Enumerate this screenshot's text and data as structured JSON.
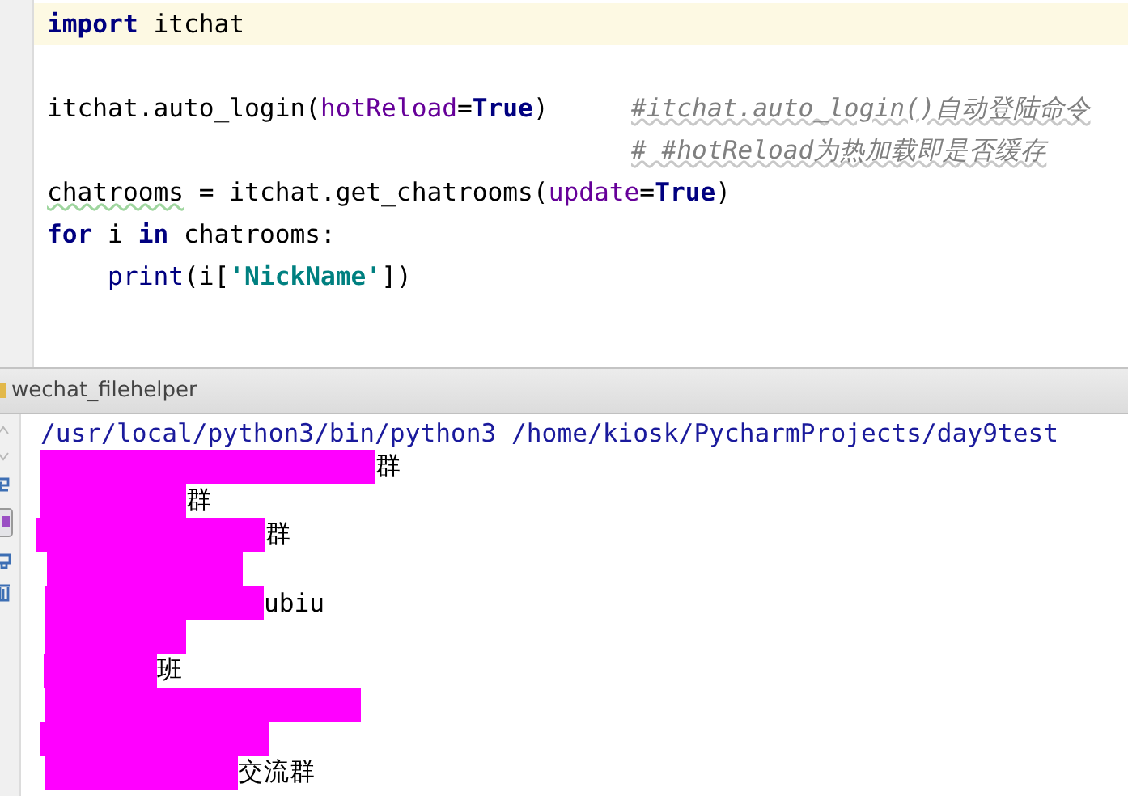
{
  "editor": {
    "lines": [
      {
        "current": true,
        "tokens": [
          {
            "kind": "keyword",
            "text": "import"
          },
          {
            "kind": "plain",
            "text": " itchat"
          }
        ]
      },
      {
        "current": false
      },
      {
        "current": false,
        "tokens": [
          {
            "kind": "plain",
            "text": "itchat.auto_login("
          },
          {
            "kind": "param",
            "text": "hotReload"
          },
          {
            "kind": "plain",
            "text": "="
          },
          {
            "kind": "keyword",
            "text": "True"
          },
          {
            "kind": "plain",
            "text": ")"
          }
        ],
        "comment": "#itchat.auto_login()自动登陆命令"
      },
      {
        "current": false,
        "comment": "# #hotReload为热加载即是否缓存"
      },
      {
        "current": false,
        "tokens": [
          {
            "kind": "warn",
            "text": "chatrooms"
          },
          {
            "kind": "plain",
            "text": " = itchat.get_chatrooms("
          },
          {
            "kind": "param",
            "text": "update"
          },
          {
            "kind": "plain",
            "text": "="
          },
          {
            "kind": "keyword",
            "text": "True"
          },
          {
            "kind": "plain",
            "text": ")"
          }
        ]
      },
      {
        "current": false,
        "tokens": [
          {
            "kind": "keyword",
            "text": "for"
          },
          {
            "kind": "plain",
            "text": " i "
          },
          {
            "kind": "keyword",
            "text": "in"
          },
          {
            "kind": "plain",
            "text": " chatrooms:"
          }
        ]
      },
      {
        "current": false,
        "tokens": [
          {
            "kind": "builtin",
            "text": "    print"
          },
          {
            "kind": "plain",
            "text": "(i["
          },
          {
            "kind": "string",
            "text": "'NickName'"
          },
          {
            "kind": "plain",
            "text": "])"
          }
        ]
      }
    ]
  },
  "run_panel": {
    "title": "wechat_filehelper",
    "command": "/usr/local/python3/bin/python3 /home/kiosk/PycharmProjects/day9test",
    "output": [
      {
        "redacted": true,
        "text": "群"
      },
      {
        "redacted": true,
        "text": "群"
      },
      {
        "redacted": true,
        "text": "群"
      },
      {
        "redacted": true
      },
      {
        "redacted": true,
        "text": "ubiu"
      },
      {
        "redacted": true
      },
      {
        "redacted": true,
        "text": "班"
      },
      {
        "redacted": true
      },
      {
        "redacted": true
      },
      {
        "redacted": true,
        "text": "交流群"
      }
    ]
  }
}
